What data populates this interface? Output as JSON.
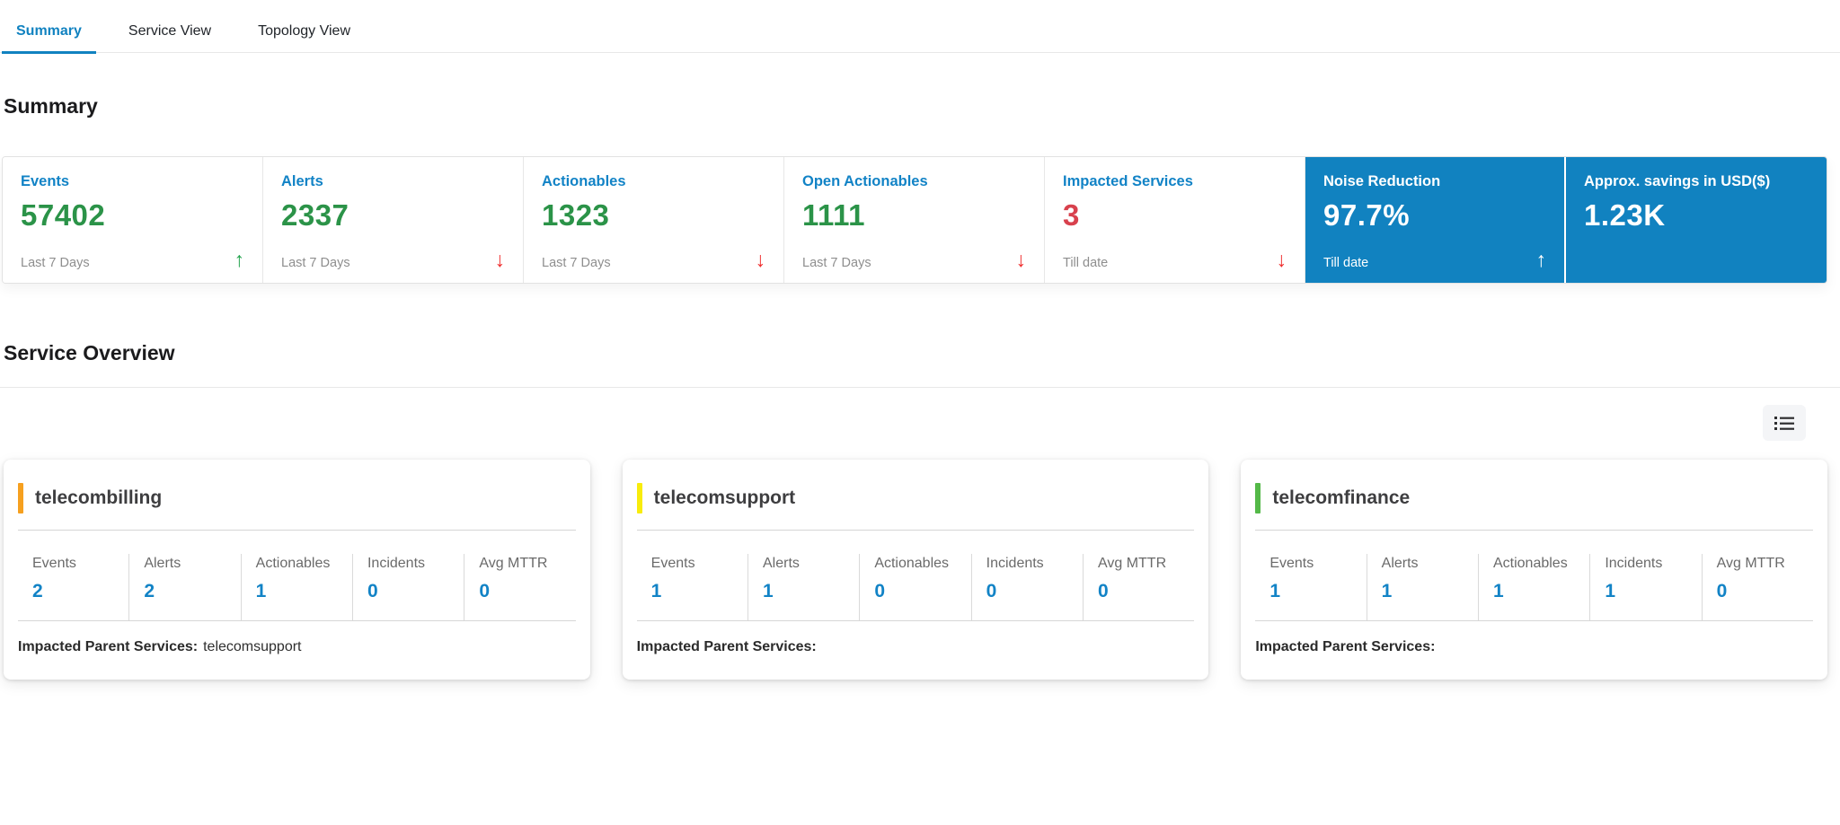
{
  "tabs": [
    {
      "label": "Summary",
      "active": true
    },
    {
      "label": "Service View",
      "active": false
    },
    {
      "label": "Topology View",
      "active": false
    }
  ],
  "headings": {
    "summary": "Summary",
    "service_overview": "Service Overview"
  },
  "labels": {
    "impacted_parent_services": "Impacted Parent Services:"
  },
  "icons": {
    "trend_up": "↑",
    "trend_down": "↓",
    "list_view": "list-bullets-icon"
  },
  "colors": {
    "brand_blue": "#1182c0",
    "kpi_title_blue": "#1283c6",
    "kpi_value_green": "#2b9348",
    "kpi_value_red": "#d8414d",
    "trend_up_green": "#21a24c",
    "trend_down_red": "#ef2f2f",
    "highlight_card_bg": "#1182c0",
    "accent_orange": "#f6a01f",
    "accent_yellow": "#f8ec0c",
    "accent_green": "#54b948"
  },
  "kpis": [
    {
      "title": "Events",
      "value": "57402",
      "period": "Last 7 Days",
      "trend": "up"
    },
    {
      "title": "Alerts",
      "value": "2337",
      "period": "Last 7 Days",
      "trend": "down"
    },
    {
      "title": "Actionables",
      "value": "1323",
      "period": "Last 7 Days",
      "trend": "down"
    },
    {
      "title": "Open Actionables",
      "value": "1111",
      "period": "Last 7 Days",
      "trend": "down"
    },
    {
      "title": "Impacted Services",
      "value": "3",
      "period": "Till date",
      "trend": "down"
    },
    {
      "title": "Noise Reduction",
      "value": "97.7%",
      "period": "Till date",
      "trend": "up"
    },
    {
      "title": "Approx. savings in USD($)",
      "value": "1.23K",
      "period": "",
      "trend": "none"
    }
  ],
  "services": [
    {
      "name": "telecombilling",
      "accent": "#f6a01f",
      "stats": [
        {
          "label": "Events",
          "value": "2"
        },
        {
          "label": "Alerts",
          "value": "2"
        },
        {
          "label": "Actionables",
          "value": "1"
        },
        {
          "label": "Incidents",
          "value": "0"
        },
        {
          "label": "Avg MTTR",
          "value": "0"
        }
      ],
      "impacted_parent_services": "telecomsupport"
    },
    {
      "name": "telecomsupport",
      "accent": "#f8ec0c",
      "stats": [
        {
          "label": "Events",
          "value": "1"
        },
        {
          "label": "Alerts",
          "value": "1"
        },
        {
          "label": "Actionables",
          "value": "0"
        },
        {
          "label": "Incidents",
          "value": "0"
        },
        {
          "label": "Avg MTTR",
          "value": "0"
        }
      ],
      "impacted_parent_services": ""
    },
    {
      "name": "telecomfinance",
      "accent": "#54b948",
      "stats": [
        {
          "label": "Events",
          "value": "1"
        },
        {
          "label": "Alerts",
          "value": "1"
        },
        {
          "label": "Actionables",
          "value": "1"
        },
        {
          "label": "Incidents",
          "value": "1"
        },
        {
          "label": "Avg MTTR",
          "value": "0"
        }
      ],
      "impacted_parent_services": ""
    }
  ]
}
